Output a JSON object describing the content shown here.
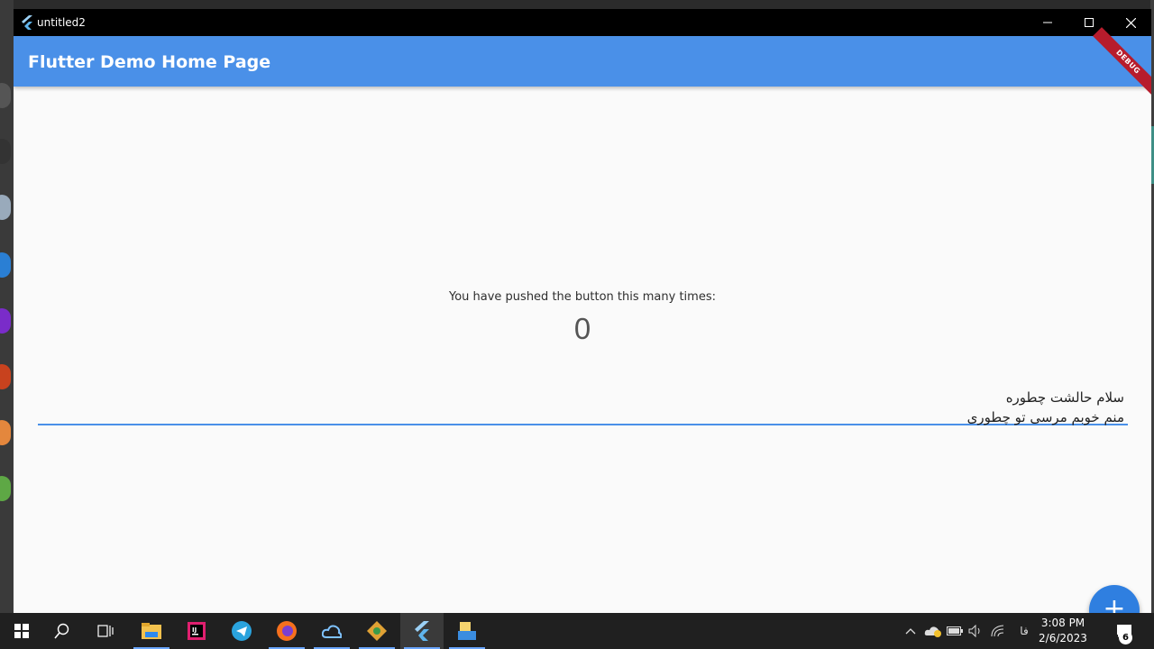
{
  "window": {
    "title": "untitled2",
    "controls": {
      "minimize": "minimize",
      "maximize": "maximize",
      "close": "close"
    }
  },
  "appbar": {
    "title": "Flutter Demo Home Page",
    "debug_banner": "DEBUG"
  },
  "body": {
    "counter_label": "You have pushed the button this many times:",
    "counter_value": "0",
    "textfield_lines": [
      "سلام حالشت چطوره",
      "منم خوبم مرسی تو چطوری"
    ]
  },
  "fab": {
    "label": "+"
  },
  "taskbar": {
    "apps": [
      "windows-start-icon",
      "search-icon",
      "task-view-icon",
      "file-explorer-icon",
      "intellij-icon",
      "telegram-icon",
      "firefox-icon",
      "cloud-app-icon",
      "git-app-icon",
      "flutter-icon",
      "files-app-icon"
    ],
    "tray": {
      "lang": "فا",
      "time": "3:08 PM",
      "date": "2/6/2023",
      "notifications": "6"
    }
  },
  "colors": {
    "appbar": "#4a90e8",
    "fab": "#2f7fe0",
    "debug": "#b71c2c",
    "titlebar": "#000000",
    "taskbar": "#202020"
  }
}
